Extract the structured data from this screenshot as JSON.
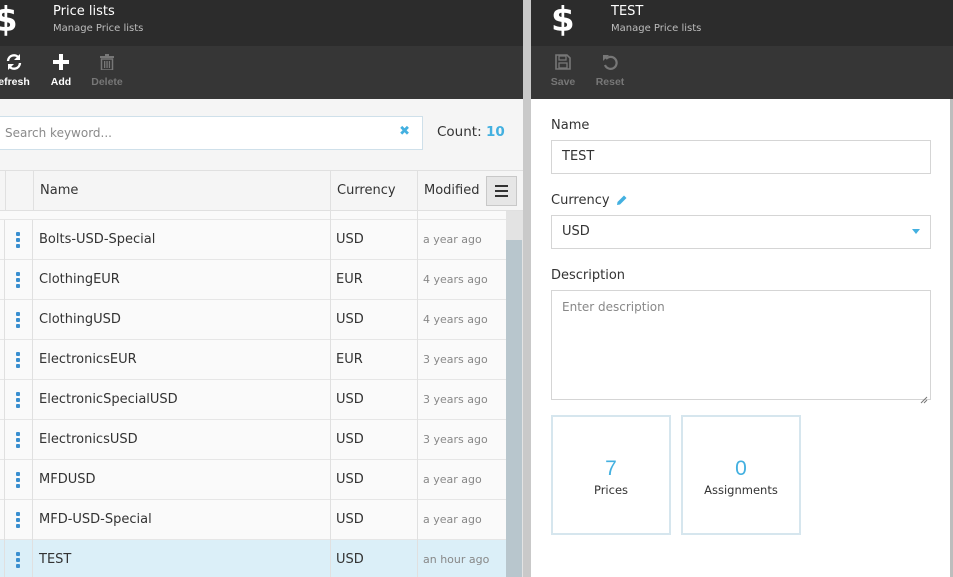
{
  "left_blade": {
    "icon": "dollar-icon",
    "title": "Price lists",
    "subtitle": "Manage Price lists",
    "toolbar": {
      "refresh_label": "efresh",
      "add_label": "Add",
      "delete_label": "Delete"
    },
    "search": {
      "placeholder": "Search keyword...",
      "value": ""
    },
    "count_label": "Count:",
    "count_value": "10",
    "columns": {
      "name": "Name",
      "currency": "Currency",
      "modified": "Modified"
    },
    "rows": [
      {
        "name": "Bolts-USD-Special",
        "currency": "USD",
        "modified": "a year ago"
      },
      {
        "name": "ClothingEUR",
        "currency": "EUR",
        "modified": "4 years ago"
      },
      {
        "name": "ClothingUSD",
        "currency": "USD",
        "modified": "4 years ago"
      },
      {
        "name": "ElectronicsEUR",
        "currency": "EUR",
        "modified": "3 years ago"
      },
      {
        "name": "ElectronicSpecialUSD",
        "currency": "USD",
        "modified": "3 years ago"
      },
      {
        "name": "ElectronicsUSD",
        "currency": "USD",
        "modified": "3 years ago"
      },
      {
        "name": "MFDUSD",
        "currency": "USD",
        "modified": "a year ago"
      },
      {
        "name": "MFD-USD-Special",
        "currency": "USD",
        "modified": "a year ago"
      },
      {
        "name": "TEST",
        "currency": "USD",
        "modified": "an hour ago",
        "selected": true
      }
    ]
  },
  "right_blade": {
    "icon": "dollar-icon",
    "title": "TEST",
    "subtitle": "Manage Price lists",
    "toolbar": {
      "save_label": "Save",
      "reset_label": "Reset"
    },
    "name_label": "Name",
    "name_value": "TEST",
    "currency_label": "Currency",
    "currency_value": "USD",
    "description_label": "Description",
    "description_placeholder": "Enter description",
    "widgets": [
      {
        "value": "7",
        "label": "Prices"
      },
      {
        "value": "0",
        "label": "Assignments"
      }
    ]
  },
  "colors": {
    "accent": "#43b0e0",
    "header_bg": "#2c2c2c",
    "toolbar_bg": "#363636",
    "selected_row": "#dbeff8"
  }
}
